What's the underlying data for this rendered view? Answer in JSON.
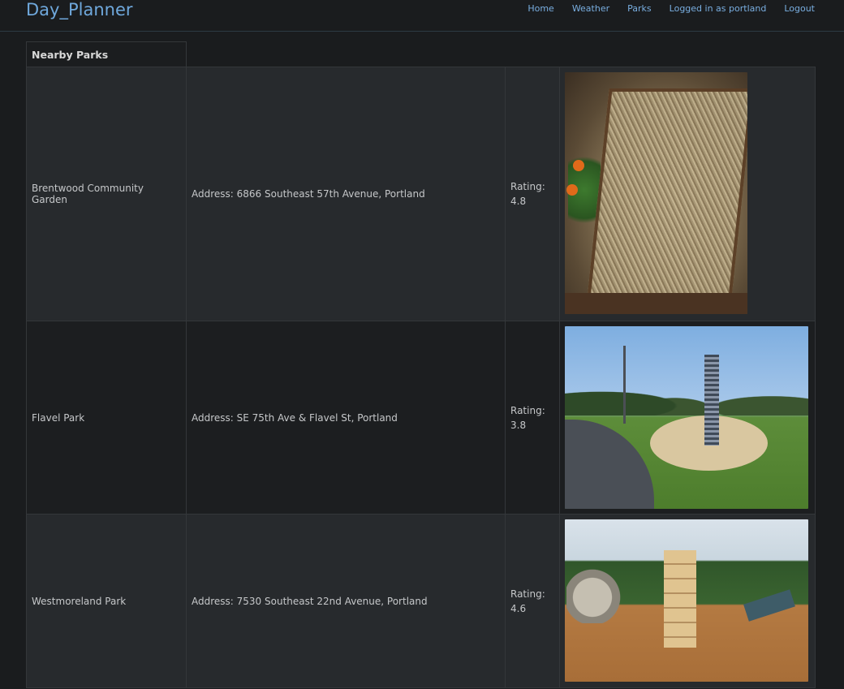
{
  "app": {
    "title": "Day_Planner"
  },
  "nav": {
    "home": "Home",
    "weather": "Weather",
    "parks": "Parks",
    "user": "Logged in as portland",
    "logout": "Logout"
  },
  "table": {
    "header": "Nearby Parks",
    "rows": [
      {
        "name": "Brentwood Community Garden",
        "address": "Address: 6866 Southeast 57th Avenue, Portland",
        "rating_label": "Rating:",
        "rating": "4.8",
        "photo": "garden-raised-bed-photo"
      },
      {
        "name": "Flavel Park",
        "address": "Address: SE 75th Ave & Flavel St, Portland",
        "rating_label": "Rating:",
        "rating": "3.8",
        "photo": "park-playground-slide-photo"
      },
      {
        "name": "Westmoreland Park",
        "address": "Address: 7530 Southeast 22nd Avenue, Portland",
        "rating_label": "Rating:",
        "rating": "4.6",
        "photo": "playground-nature-play-photo"
      }
    ]
  },
  "colors": {
    "background": "#1a1c1e",
    "brand": "#6fa8dc",
    "link": "#79aee0"
  }
}
